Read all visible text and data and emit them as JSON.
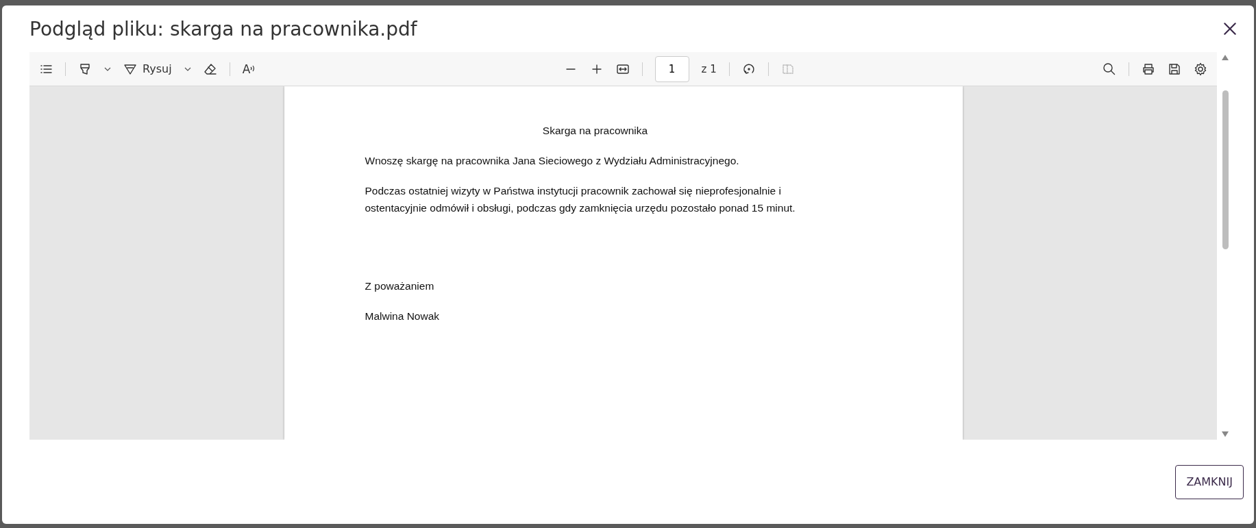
{
  "dialog": {
    "title": "Podgląd pliku: skarga na pracownika.pdf"
  },
  "toolbar": {
    "draw_label": "Rysuj",
    "read_aloud_label": "A",
    "page_value": "1",
    "page_count": "z 1"
  },
  "document": {
    "heading": "Skarga na pracownika",
    "paragraphs": [
      {
        "kind": "text",
        "text": "Wnoszę skargę na pracownika Jana Sieciowego z Wydziału Administracyjnego."
      },
      {
        "kind": "text",
        "text": "Podczas ostatniej wizyty w Państwa instytucji pracownik zachował się nieprofesjonalnie i ostentacyjnie odmówił i obsługi, podczas gdy zamknięcia urzędu pozostało ponad 15 minut."
      },
      {
        "kind": "gap"
      },
      {
        "kind": "text",
        "text": "Z poważaniem"
      },
      {
        "kind": "text",
        "text": "Malwina Nowak"
      }
    ]
  },
  "buttons": [
    "ZAMKNIJ"
  ]
}
